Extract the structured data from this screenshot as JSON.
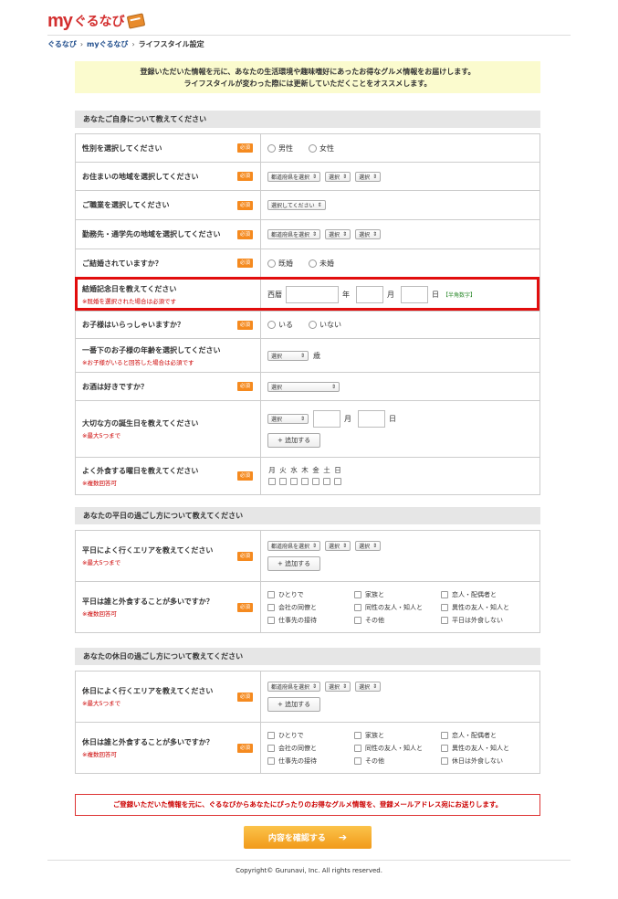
{
  "logo": {
    "my": "my",
    "brand": "ぐるなび"
  },
  "breadcrumb": [
    "ぐるなび",
    "myぐるなび",
    "ライフスタイル設定"
  ],
  "notice": {
    "line1": "登録いただいた情報を元に、あなたの生活環境や趣味嗜好にあったお得なグルメ情報をお届けします。",
    "line2": "ライフスタイルが変わった際には更新していただくことをオススメします。"
  },
  "required": "必須",
  "sections": {
    "self": "あなたご自身について教えてください",
    "weekday": "あなたの平日の過ごし方について教えてください",
    "holiday": "あなたの休日の過ごし方について教えてください"
  },
  "rows": {
    "gender": {
      "label": "性別を選択してください",
      "options": [
        "男性",
        "女性"
      ]
    },
    "home": {
      "label": "お住まいの地域を選択してください",
      "selects": [
        "都道府県を選択",
        "選択",
        "選択"
      ]
    },
    "job": {
      "label": "ご職業を選択してください",
      "select": "選択してください"
    },
    "work": {
      "label": "勤務先・通学先の地域を選択してください",
      "selects": [
        "都道府県を選択",
        "選択",
        "選択"
      ]
    },
    "married": {
      "label": "ご結婚されていますか？",
      "options": [
        "既婚",
        "未婚"
      ]
    },
    "anniv": {
      "label": "結婚記念日を教えてください",
      "sub": "※既婚を選択された場合は必須です",
      "era": "西暦",
      "year": "年",
      "month": "月",
      "day": "日",
      "hint": "【半角数字】"
    },
    "kids": {
      "label": "お子様はいらっしゃいますか？",
      "options": [
        "いる",
        "いない"
      ]
    },
    "kidage": {
      "label": "一番下のお子様の年齢を選択してください",
      "sub": "※お子様がいると回答した場合は必須です",
      "select": "選択",
      "unit": "歳"
    },
    "alcohol": {
      "label": "お酒は好きですか？",
      "select": "選択"
    },
    "birthday": {
      "label": "大切な方の誕生日を教えてください",
      "sub": "※最大5つまで",
      "select": "選択",
      "month": "月",
      "day": "日",
      "add": "+ 追加する"
    },
    "dineday": {
      "label": "よく外食する曜日を教えてください",
      "sub": "※複数回答可",
      "days": [
        "月",
        "火",
        "水",
        "木",
        "金",
        "土",
        "日"
      ]
    },
    "wd_area": {
      "label": "平日によく行くエリアを教えてください",
      "sub": "※最大5つまで",
      "selects": [
        "都道府県を選択",
        "選択",
        "選択"
      ],
      "add": "+ 追加する"
    },
    "wd_who": {
      "label": "平日は誰と外食することが多いですか？",
      "sub": "※複数回答可",
      "options": [
        "ひとりで",
        "家族と",
        "恋人・配偶者と",
        "会社の同僚と",
        "同性の友人・知人と",
        "異性の友人・知人と",
        "仕事先の接待",
        "その他",
        "平日は外食しない"
      ]
    },
    "hd_area": {
      "label": "休日によく行くエリアを教えてください",
      "sub": "※最大5つまで",
      "selects": [
        "都道府県を選択",
        "選択",
        "選択"
      ],
      "add": "+ 追加する"
    },
    "hd_who": {
      "label": "休日は誰と外食することが多いですか？",
      "sub": "※複数回答可",
      "options": [
        "ひとりで",
        "家族と",
        "恋人・配偶者と",
        "会社の同僚と",
        "同性の友人・知人と",
        "異性の友人・知人と",
        "仕事先の接待",
        "その他",
        "休日は外食しない"
      ]
    }
  },
  "footer_notice": "ご登録いただいた情報を元に、ぐるなびからあなたにぴったりのお得なグルメ情報を、登録メールアドレス宛にお送りします。",
  "confirm_button": "内容を確認する",
  "copyright": "Copyright© Gurunavi, Inc. All rights reserved."
}
